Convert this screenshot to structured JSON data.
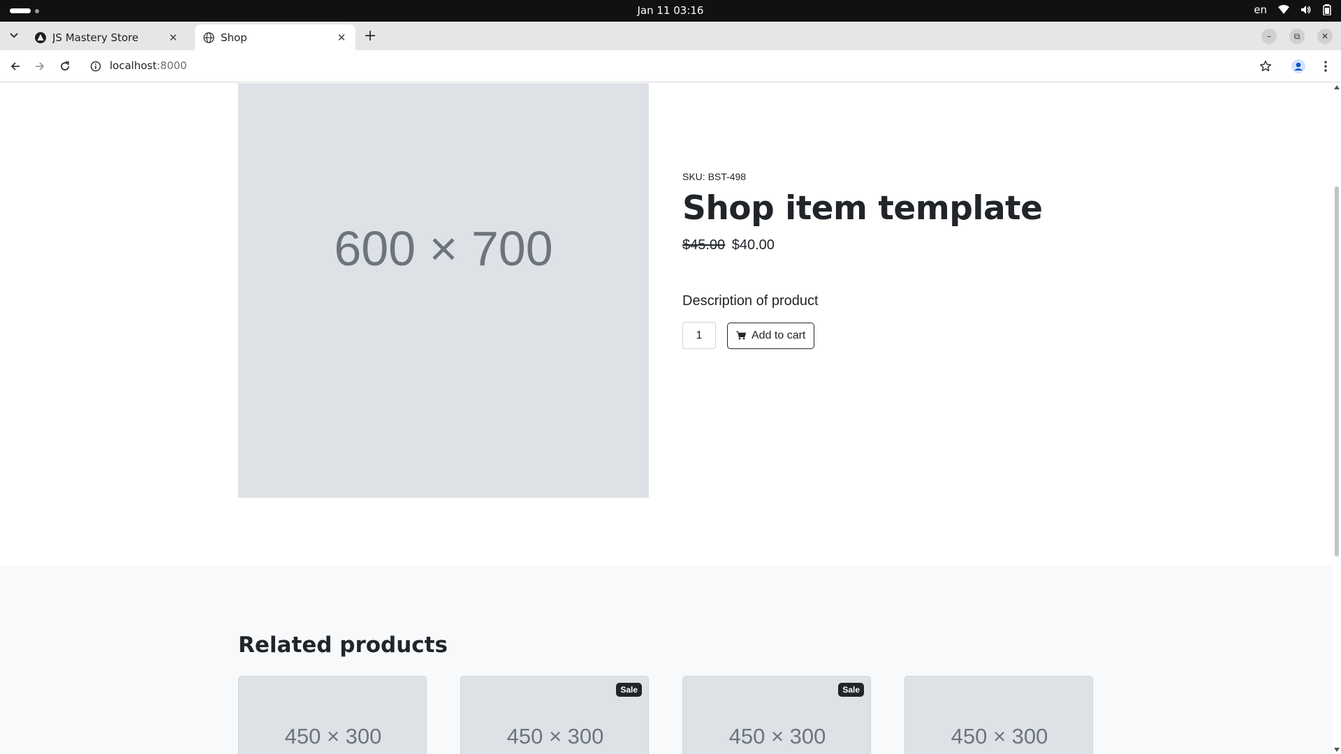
{
  "os": {
    "clock": "Jan 11  03:16",
    "lang": "en"
  },
  "browser": {
    "tabs": [
      {
        "title": "JS Mastery Store",
        "active": false
      },
      {
        "title": "Shop",
        "active": true
      }
    ],
    "url": {
      "host": "localhost",
      "port": ":8000"
    },
    "window_controls": {
      "minimize": "–",
      "restore": "⧉",
      "close": "✕"
    }
  },
  "product": {
    "image_placeholder": "600 × 700",
    "sku": "SKU: BST-498",
    "title": "Shop item template",
    "old_price": "$45.00",
    "price": "$40.00",
    "description": "Description of product",
    "quantity": "1",
    "add_to_cart_label": "Add to cart"
  },
  "related": {
    "title": "Related products",
    "cards": [
      {
        "placeholder": "450 × 300",
        "badge": ""
      },
      {
        "placeholder": "450 × 300",
        "badge": "Sale"
      },
      {
        "placeholder": "450 × 300",
        "badge": "Sale"
      },
      {
        "placeholder": "450 × 300",
        "badge": ""
      }
    ]
  },
  "colors": {
    "text": "#212529",
    "placeholder_bg": "#dee2e6",
    "placeholder_text": "#6c757d",
    "section_bg": "#f8f9fa"
  }
}
